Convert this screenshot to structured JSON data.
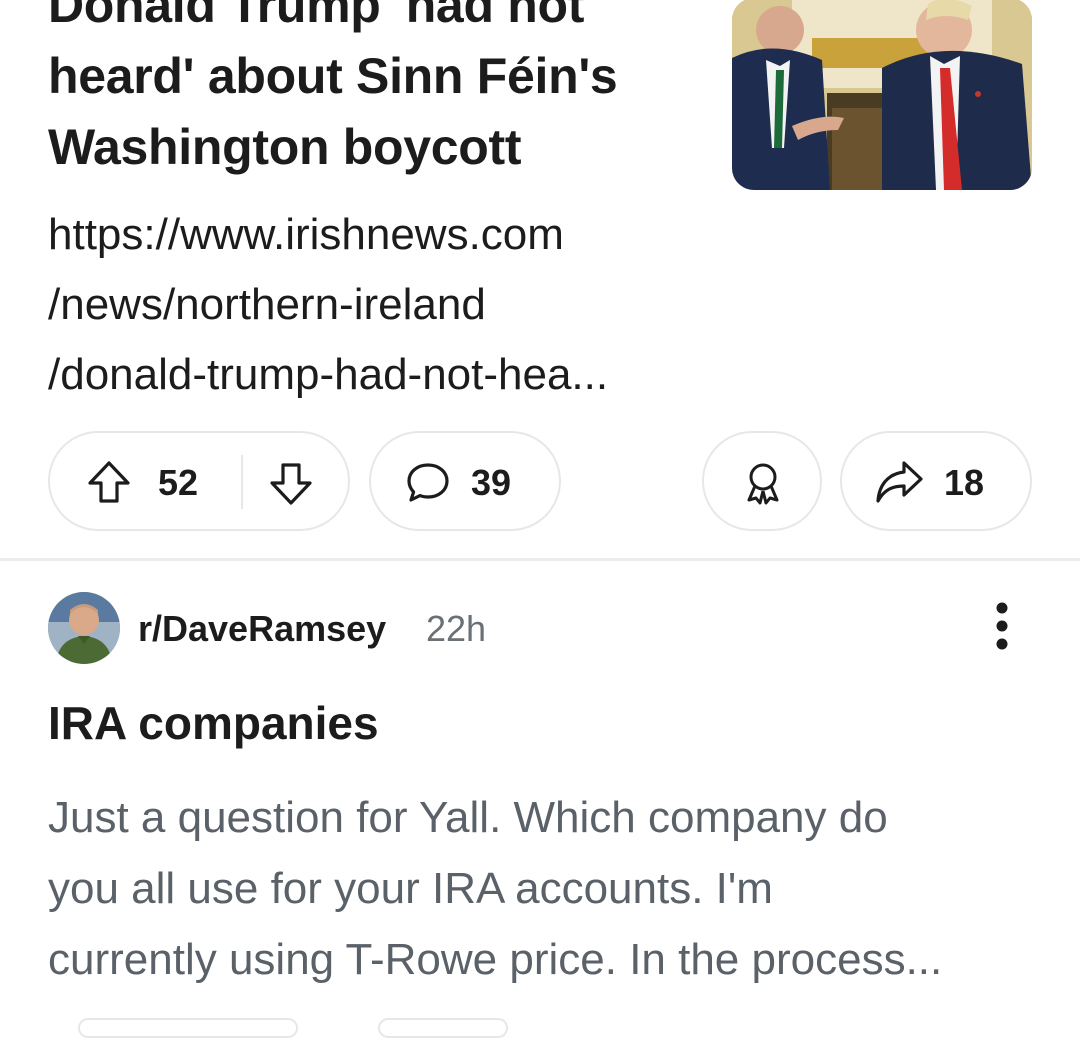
{
  "post1": {
    "title_lines": [
      "Donald Trump 'had not",
      "heard' about Sinn Féin's",
      "Washington boycott"
    ],
    "link_lines": [
      "https://www.irishnews.com",
      "/news/northern-ireland",
      "/donald-trump-had-not-hea..."
    ],
    "upvotes": "52",
    "comments": "39",
    "shares": "18",
    "icons": {
      "upvote": "arrow-up-icon",
      "downvote": "arrow-down-icon",
      "comment": "comment-bubble-icon",
      "award": "award-icon",
      "share": "share-arrow-icon"
    }
  },
  "post2": {
    "subreddit": "r/DaveRamsey",
    "time": "22h",
    "title": "IRA companies",
    "body_lines": [
      "Just a question for Yall. Which company do",
      "you all use for your IRA accounts. I'm",
      "currently using T-Rowe price. In the process..."
    ]
  },
  "colors": {
    "text": "#1c1c1c",
    "muted": "#6a7176",
    "pill_border": "#e5e7e9"
  }
}
